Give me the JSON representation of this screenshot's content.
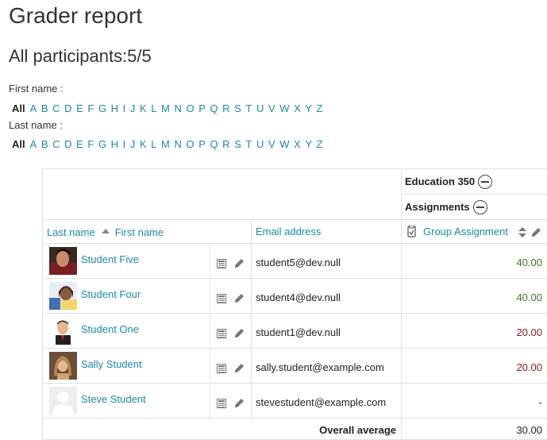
{
  "page": {
    "title": "Grader report",
    "participants": "All participants:5/5"
  },
  "filters": {
    "first_name_label": "First name :",
    "last_name_label": "Last name :",
    "letters": [
      "All",
      "A",
      "B",
      "C",
      "D",
      "E",
      "F",
      "G",
      "H",
      "I",
      "J",
      "K",
      "L",
      "M",
      "N",
      "O",
      "P",
      "Q",
      "R",
      "S",
      "T",
      "U",
      "V",
      "W",
      "X",
      "Y",
      "Z"
    ],
    "selected": "All"
  },
  "grade_table": {
    "course": "Education 350",
    "category": "Assignments",
    "headers": {
      "last_name": "Last name",
      "first_name": "First name",
      "email": "Email address",
      "item": "Group Assignment"
    },
    "rows": [
      {
        "name": "Student Five",
        "email": "student5@dev.null",
        "grade": "40.00",
        "grade_color": "#3a7d22"
      },
      {
        "name": "Student Four",
        "email": "student4@dev.null",
        "grade": "40.00",
        "grade_color": "#3a7d22"
      },
      {
        "name": "Student One",
        "email": "student1@dev.null",
        "grade": "20.00",
        "grade_color": "#8b1a1a"
      },
      {
        "name": "Sally Student",
        "email": "sally.student@example.com",
        "grade": "20.00",
        "grade_color": "#8b1a1a"
      },
      {
        "name": "Steve Student",
        "email": "stevestudent@example.com",
        "grade": "-",
        "grade_color": "#333333"
      }
    ],
    "overall_label": "Overall average",
    "overall_value": "30.00"
  },
  "colors": {
    "link": "#1a8aa6",
    "border": "#dee2e6",
    "pass": "#3a7d22",
    "fail": "#8b1a1a"
  },
  "icons": {
    "sort_asc": "sort-ascending-icon",
    "sort_both": "sort-icon",
    "edit": "pencil-icon",
    "report": "single-view-icon",
    "collapse": "collapse-icon",
    "assignment": "assignment-icon"
  }
}
